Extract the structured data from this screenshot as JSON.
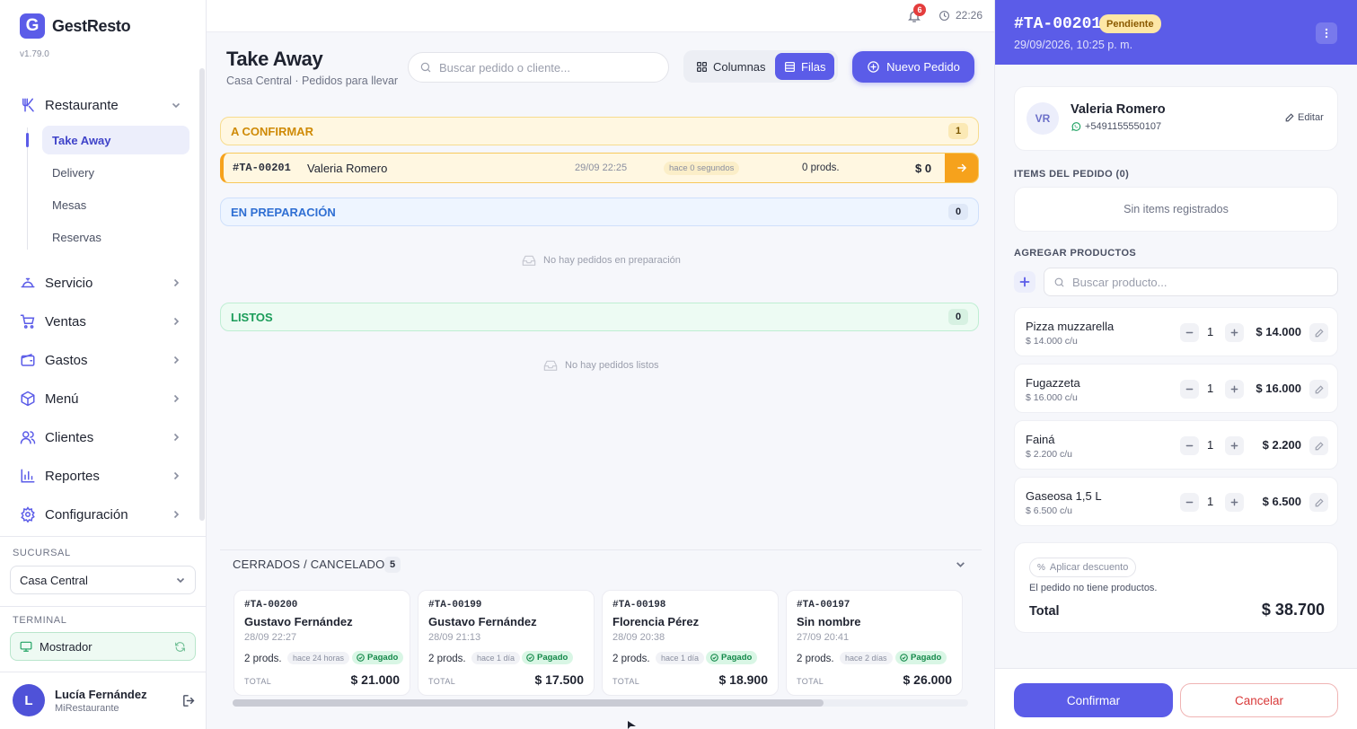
{
  "app": {
    "name": "GestResto",
    "logo_letter": "G",
    "version": "v1.79.0"
  },
  "sidebar": {
    "restaurante": {
      "label": "Restaurante",
      "items": [
        "Take Away",
        "Delivery",
        "Mesas",
        "Reservas"
      ]
    },
    "groups": [
      "Servicio",
      "Ventas",
      "Gastos",
      "Menú",
      "Clientes",
      "Reportes",
      "Configuración"
    ],
    "branch_label": "SUCURSAL",
    "branch_value": "Casa Central",
    "terminal_label": "TERMINAL",
    "terminal_value": "Mostrador",
    "user": {
      "initial": "L",
      "name": "Lucía Fernández",
      "org": "MiRestaurante"
    }
  },
  "topbar": {
    "notifications": "6",
    "time": "22:26"
  },
  "header": {
    "title": "Take Away",
    "subtitle": "Casa Central · Pedidos para llevar",
    "search_placeholder": "Buscar pedido o cliente...",
    "view_columns": "Columnas",
    "view_rows": "Filas",
    "new_order": "Nuevo Pedido"
  },
  "sections": {
    "confirm": {
      "title": "A CONFIRMAR",
      "count": "1"
    },
    "prep": {
      "title": "EN PREPARACIÓN",
      "count": "0",
      "empty": "No hay pedidos en preparación"
    },
    "ready": {
      "title": "LISTOS",
      "count": "0",
      "empty": "No hay pedidos listos"
    }
  },
  "pending_order": {
    "id": "#TA-00201",
    "customer": "Valeria Romero",
    "datetime": "29/09 22:25",
    "ago": "hace 0 segundos",
    "products": "0 prods.",
    "amount": "$ 0"
  },
  "closed": {
    "title": "CERRADOS / CANCELADOS",
    "count": "5",
    "total_label": "TOTAL",
    "paid_label": "Pagado",
    "cards": [
      {
        "id": "#TA-00200",
        "customer": "Gustavo Fernández",
        "datetime": "28/09 22:27",
        "products": "2 prods.",
        "ago": "hace 24 horas",
        "total": "$ 21.000"
      },
      {
        "id": "#TA-00199",
        "customer": "Gustavo Fernández",
        "datetime": "28/09 21:13",
        "products": "2 prods.",
        "ago": "hace 1 día",
        "total": "$ 17.500"
      },
      {
        "id": "#TA-00198",
        "customer": "Florencia Pérez",
        "datetime": "28/09 20:38",
        "products": "2 prods.",
        "ago": "hace 1 día",
        "total": "$ 18.900"
      },
      {
        "id": "#TA-00197",
        "customer": "Sin nombre",
        "datetime": "27/09 20:41",
        "products": "2 prods.",
        "ago": "hace 2 días",
        "total": "$ 26.000"
      }
    ]
  },
  "panel": {
    "order_id": "#TA-00201",
    "status": "Pendiente",
    "datetime": "29/09/2026, 10:25 p. m.",
    "customer": {
      "initials": "VR",
      "name": "Valeria Romero",
      "phone": "+5491155550107",
      "edit": "Editar"
    },
    "items_label": "ITEMS DEL PEDIDO (0)",
    "no_items": "Sin items registrados",
    "add_label": "AGREGAR PRODUCTOS",
    "product_search_placeholder": "Buscar producto...",
    "products": [
      {
        "name": "Pizza muzzarella",
        "unit": "$ 14.000 c/u",
        "qty": "1",
        "price": "$ 14.000"
      },
      {
        "name": "Fugazzeta",
        "unit": "$ 16.000 c/u",
        "qty": "1",
        "price": "$ 16.000"
      },
      {
        "name": "Fainá",
        "unit": "$ 2.200 c/u",
        "qty": "1",
        "price": "$ 2.200"
      },
      {
        "name": "Gaseosa 1,5 L",
        "unit": "$ 6.500 c/u",
        "qty": "1",
        "price": "$ 6.500"
      }
    ],
    "discount": "Aplicar descuento",
    "no_products": "El pedido no tiene productos.",
    "total_label": "Total",
    "total_value": "$ 38.700",
    "confirm": "Confirmar",
    "cancel": "Cancelar"
  },
  "colors": {
    "accent": "#5b5ce8",
    "warning": "#f6a21c",
    "success": "#1ea262",
    "danger": "#d93a3a"
  }
}
